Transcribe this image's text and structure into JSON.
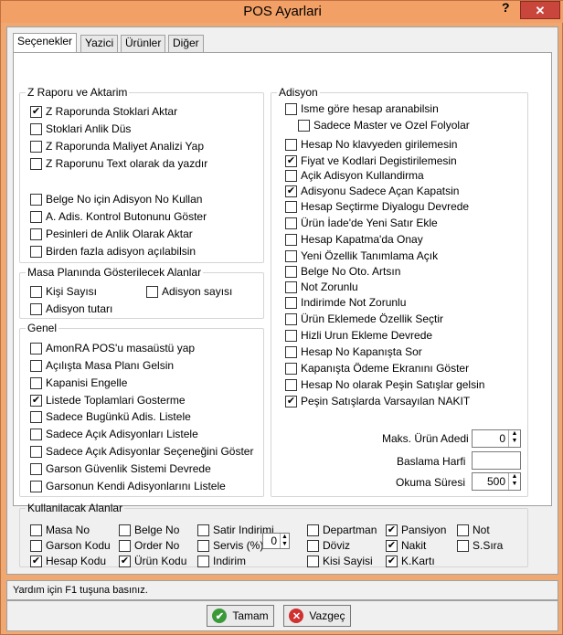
{
  "window": {
    "title": "POS Ayarlari",
    "help": "?",
    "close": "✕"
  },
  "tabs": [
    "Seçenekler",
    "Yazici",
    "Ürünler",
    "Diğer"
  ],
  "zrapor": {
    "legend": "Z Raporu ve Aktarim",
    "items": [
      {
        "label": "Z Raporunda Stoklari Aktar",
        "checked": true
      },
      {
        "label": "Stoklari Anlik Düs",
        "checked": false
      },
      {
        "label": "Z Raporunda Maliyet Analizi Yap",
        "checked": false
      },
      {
        "label": "Z Raporunu Text olarak da yazdır",
        "checked": false
      },
      {
        "label": "Belge No için Adisyon No Kullan",
        "checked": false
      },
      {
        "label": "A. Adis. Kontrol Butonunu Göster",
        "checked": false
      },
      {
        "label": "Pesinleri de Anlik Olarak Aktar",
        "checked": false
      },
      {
        "label": "Birden fazla adisyon açılabilsin",
        "checked": false
      }
    ]
  },
  "masa": {
    "legend": "Masa Planında Gösterilecek Alanlar",
    "items": [
      {
        "label": "Kişi Sayısı",
        "checked": false
      },
      {
        "label": "Adisyon sayısı",
        "checked": false
      },
      {
        "label": "Adisyon tutarı",
        "checked": false
      }
    ]
  },
  "genel": {
    "legend": "Genel",
    "items": [
      {
        "label": "AmonRA POS'u masaüstü yap",
        "checked": false
      },
      {
        "label": "Açılışta Masa Planı Gelsin",
        "checked": false
      },
      {
        "label": "Kapanisi Engelle",
        "checked": false
      },
      {
        "label": "Listede Toplamlari Gosterme",
        "checked": true
      },
      {
        "label": "Sadece Bugünkü Adis. Listele",
        "checked": false
      },
      {
        "label": "Sadece Açık Adisyonları Listele",
        "checked": false
      },
      {
        "label": "Sadece Açık Adisyonlar Seçeneğini Göster",
        "checked": false
      },
      {
        "label": "Garson Güvenlik Sistemi Devrede",
        "checked": false
      },
      {
        "label": "Garsonun Kendi Adisyonlarını Listele",
        "checked": false
      }
    ]
  },
  "adisyon": {
    "legend": "Adisyon",
    "items": [
      {
        "label": "Isme göre hesap aranabilsin",
        "checked": false
      },
      {
        "label": "Sadece Master ve Ozel Folyolar",
        "checked": false
      },
      {
        "label": "Hesap No klavyeden girilemesin",
        "checked": false
      },
      {
        "label": "Fiyat ve Kodlari Degistirilemesin",
        "checked": true
      },
      {
        "label": "Açik Adisyon Kullandirma",
        "checked": false
      },
      {
        "label": "Adisyonu Sadece Açan Kapatsin",
        "checked": true
      },
      {
        "label": "Hesap Seçtirme Diyalogu Devrede",
        "checked": false
      },
      {
        "label": "Ürün İade'de Yeni Satır Ekle",
        "checked": false
      },
      {
        "label": "Hesap Kapatma'da Onay",
        "checked": false
      },
      {
        "label": "Yeni Özellik Tanımlama Açık",
        "checked": false
      },
      {
        "label": "Belge No Oto. Artsın",
        "checked": false
      },
      {
        "label": "Not Zorunlu",
        "checked": false
      },
      {
        "label": "Indirimde Not Zorunlu",
        "checked": false
      },
      {
        "label": "Ürün Eklemede Özellik Seçtir",
        "checked": false
      },
      {
        "label": "Hizli Urun Ekleme Devrede",
        "checked": false
      },
      {
        "label": "Hesap No Kapanışta Sor",
        "checked": false
      },
      {
        "label": "Kapanışta Ödeme Ekranını Göster",
        "checked": false
      },
      {
        "label": "Hesap No olarak Peşin Satışlar gelsin",
        "checked": false
      },
      {
        "label": "Peşin Satışlarda Varsayılan NAKIT",
        "checked": true
      }
    ],
    "maks_label": "Maks. Ürün Adedi",
    "maks_value": "0",
    "baslama_label": "Baslama Harfi",
    "baslama_value": "",
    "okuma_label": "Okuma Süresi",
    "okuma_value": "500"
  },
  "kullan": {
    "legend": "Kullanilacak Alanlar",
    "items": [
      {
        "label": "Masa No",
        "checked": false
      },
      {
        "label": "Garson Kodu",
        "checked": false
      },
      {
        "label": "Hesap Kodu",
        "checked": true
      },
      {
        "label": "Belge No",
        "checked": false
      },
      {
        "label": "Order No",
        "checked": false
      },
      {
        "label": "Ürün Kodu",
        "checked": true
      },
      {
        "label": "Satir Indirimi",
        "checked": false
      },
      {
        "label": "Servis (%)",
        "checked": false
      },
      {
        "label": "Indirim",
        "checked": false
      },
      {
        "label": "Departman",
        "checked": false
      },
      {
        "label": "Döviz",
        "checked": false
      },
      {
        "label": "Kisi Sayisi",
        "checked": false
      },
      {
        "label": "Pansiyon",
        "checked": true
      },
      {
        "label": "Nakit",
        "checked": true
      },
      {
        "label": "K.Kartı",
        "checked": true
      },
      {
        "label": "Not",
        "checked": false
      },
      {
        "label": "S.Sıra",
        "checked": false
      }
    ],
    "servis_value": "0"
  },
  "status": "Yardım için F1 tuşuna basınız.",
  "buttons": {
    "ok": "Tamam",
    "cancel": "Vazgeç"
  },
  "colors": {
    "ok_icon": "#3a9a3a",
    "cancel_icon": "#d03030"
  }
}
